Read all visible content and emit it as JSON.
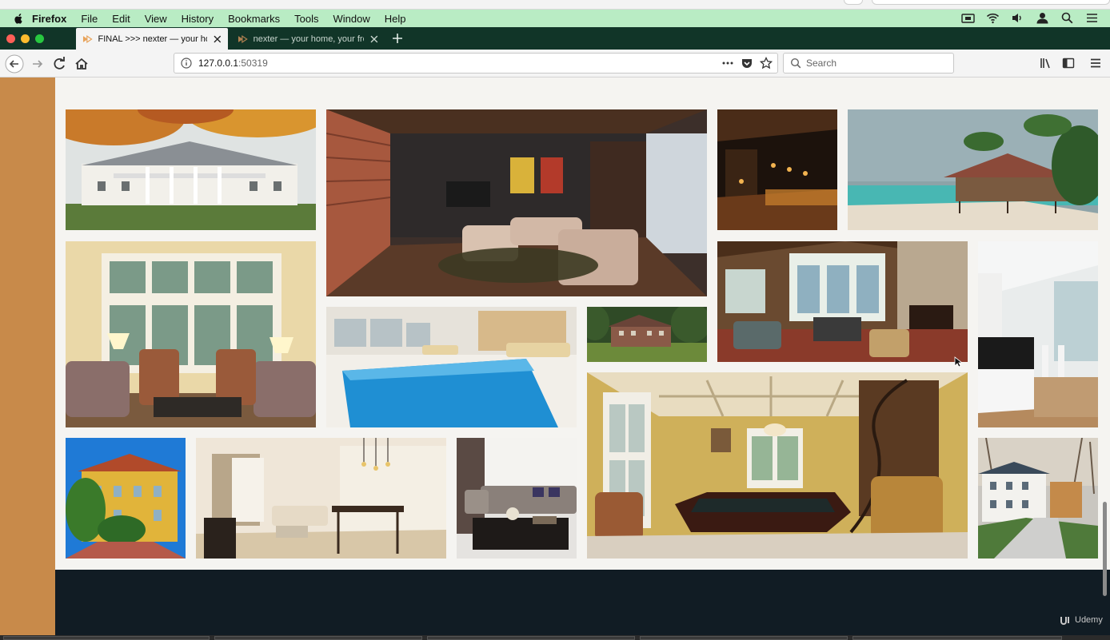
{
  "menubar": {
    "app_name": "Firefox",
    "items": [
      "File",
      "Edit",
      "View",
      "History",
      "Bookmarks",
      "Tools",
      "Window",
      "Help"
    ]
  },
  "tabs": [
    {
      "title": "FINAL >>> nexter — your home"
    },
    {
      "title": "nexter — your home, your freedom"
    }
  ],
  "navbar": {
    "url_host": "127.0.0.1",
    "url_port": ":50319",
    "search_placeholder": "Search"
  },
  "gallery": {
    "photos": [
      {
        "name": "white-colonial-mansion-autumn"
      },
      {
        "name": "living-room-dark-wood"
      },
      {
        "name": "dark-bar-lounge"
      },
      {
        "name": "beach-resort-bungalow"
      },
      {
        "name": "sunroom-armchairs"
      },
      {
        "name": "rustic-great-room"
      },
      {
        "name": "modern-white-kitchen"
      },
      {
        "name": "indoor-swimming-pool"
      },
      {
        "name": "brick-country-house"
      },
      {
        "name": "billiard-room"
      },
      {
        "name": "yellow-villa-palms"
      },
      {
        "name": "beige-dining-living-room"
      },
      {
        "name": "modern-sofa-room"
      },
      {
        "name": "white-house-driveway"
      }
    ]
  },
  "brand": {
    "label": "Udemy"
  },
  "colors": {
    "menubar": "#b9ecc4",
    "tabbar": "#113528",
    "sidestrip": "#c88a4a",
    "footer": "#111c24"
  }
}
